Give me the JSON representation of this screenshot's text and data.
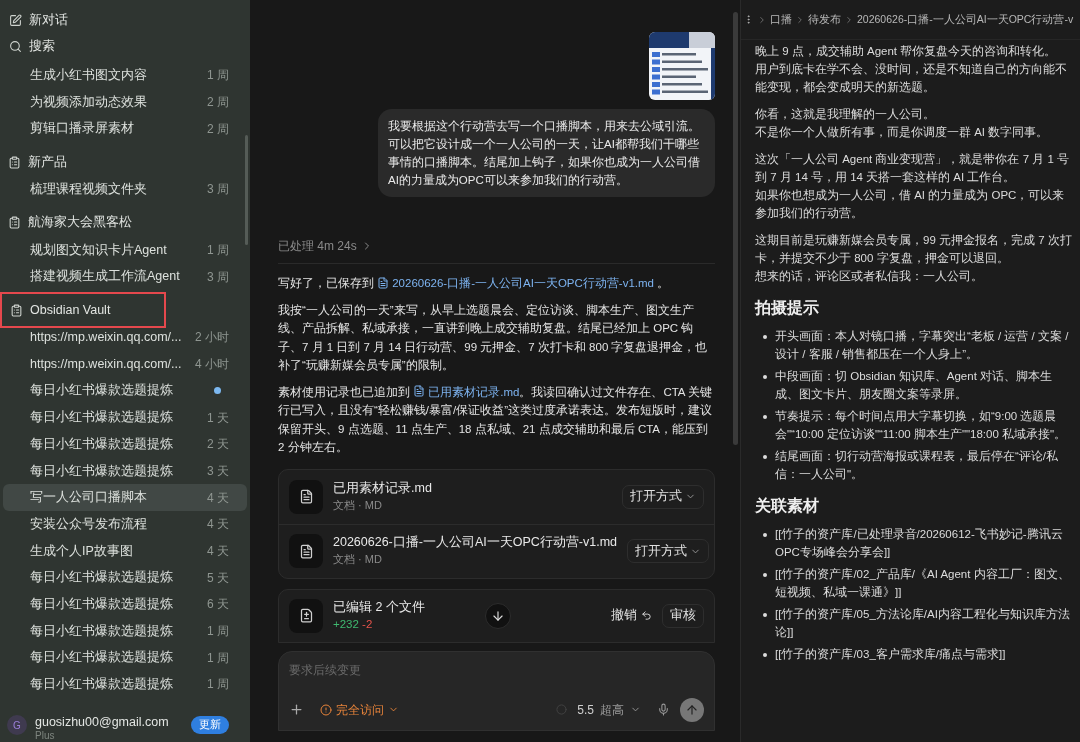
{
  "sidebar": {
    "actions": [
      {
        "kind": "new",
        "label": "新对话"
      },
      {
        "kind": "search",
        "label": "搜索"
      }
    ],
    "chats": [
      {
        "title": "生成小红书图文内容",
        "time": "1 周",
        "selected": false,
        "unread": false
      },
      {
        "title": "为视频添加动态效果",
        "time": "2 周",
        "selected": false,
        "unread": false
      },
      {
        "title": "剪辑口播录屏素材",
        "time": "2 周",
        "selected": false,
        "unread": false
      }
    ],
    "projects": [
      {
        "name": "新产品",
        "annotated": false,
        "chats": [
          {
            "title": "梳理课程视频文件夹",
            "time": "3 周",
            "selected": false,
            "unread": false
          }
        ]
      },
      {
        "name": "航海家大会黑客松",
        "annotated": false,
        "chats": [
          {
            "title": "规划图文知识卡片Agent",
            "time": "1 周",
            "selected": false,
            "unread": false
          },
          {
            "title": "搭建视频生成工作流Agent",
            "time": "3 周",
            "selected": false,
            "unread": false
          }
        ]
      },
      {
        "name": "Obsidian Vault",
        "annotated": true,
        "chats": [
          {
            "title": "https://mp.weixin.qq.com/...",
            "time": "2 小时",
            "selected": false,
            "unread": false
          },
          {
            "title": "https://mp.weixin.qq.com/...",
            "time": "4 小时",
            "selected": false,
            "unread": false
          },
          {
            "title": "每日小红书爆款选题提炼",
            "selected": false,
            "unread": true
          },
          {
            "title": "每日小红书爆款选题提炼",
            "time": "1 天",
            "selected": false,
            "unread": false
          },
          {
            "title": "每日小红书爆款选题提炼",
            "time": "2 天",
            "selected": false,
            "unread": false
          },
          {
            "title": "每日小红书爆款选题提炼",
            "time": "3 天",
            "selected": false,
            "unread": false
          },
          {
            "title": "写一人公司口播脚本",
            "time": "4 天",
            "selected": true,
            "unread": false
          },
          {
            "title": "安装公众号发布流程",
            "time": "4 天",
            "selected": false,
            "unread": false
          },
          {
            "title": "生成个人IP故事图",
            "time": "4 天",
            "selected": false,
            "unread": false
          },
          {
            "title": "每日小红书爆款选题提炼",
            "time": "5 天",
            "selected": false,
            "unread": false
          },
          {
            "title": "每日小红书爆款选题提炼",
            "time": "6 天",
            "selected": false,
            "unread": false
          },
          {
            "title": "每日小红书爆款选题提炼",
            "time": "1 周",
            "selected": false,
            "unread": false
          },
          {
            "title": "每日小红书爆款选题提炼",
            "time": "1 周",
            "selected": false,
            "unread": false
          },
          {
            "title": "每日小红书爆款选题提炼",
            "time": "1 周",
            "selected": false,
            "unread": false
          }
        ]
      }
    ],
    "account": {
      "avatar": "G",
      "email": "guosizhu00@gmail.com",
      "plan": "Plus",
      "button": "更新"
    }
  },
  "chat": {
    "attachment": {
      "kind": "picture"
    },
    "user_message": "我要根据这个行动营去写一个口播脚本，用来去公域引流。可以把它设计成一个一人公司的一天，让AI都帮我们干哪些事情的口播脚本。结尾加上钩子，如果你也成为一人公司借AI的力量成为OPC可以来参加我们的行动营。",
    "worked": "已处理 4m 24s",
    "reply": [
      [
        {
          "kind": "text",
          "text": "写好了，已保存到 "
        },
        {
          "kind": "link",
          "text": "20260626-口播-一人公司AI一天OPC行动营-v1.md"
        },
        {
          "kind": "text",
          "text": " 。"
        }
      ],
      [
        {
          "kind": "text",
          "text": "我按“一人公司的一天”来写，从早上选题晨会、定位访谈、脚本生产、图文生产线、产品拆解、私域承接，一直讲到晚上成交辅助复盘。结尾已经加上 OPC 钩子、7 月 1 日到 7 月 14 日行动营、99 元押金、7 次打卡和 800 字复盘退押金，也补了“玩赚新媒会员专属”的限制。"
        }
      ],
      [
        {
          "kind": "text",
          "text": "素材使用记录也已追加到 "
        },
        {
          "kind": "link",
          "text": "已用素材记录.md"
        },
        {
          "kind": "text",
          "text": "。我读回确认过文件存在、CTA 关键行已写入，且没有“轻松赚钱/暴富/保证收益”这类过度承诺表达。发布短版时，建议保留开头、9 点选题、11 点生产、18 点私域、21 点成交辅助和最后 CTA，能压到 2 分钟左右。"
        }
      ]
    ],
    "files": [
      {
        "name": "已用素材记录.md",
        "meta": "文档 · MD",
        "action": "打开方式"
      },
      {
        "name": "20260626-口播-一人公司AI一天OPC行动营-v1.md",
        "meta": "文档 · MD",
        "action": "打开方式"
      }
    ],
    "edits": {
      "title": "已编辑 2 个文件",
      "added": "+232",
      "removed": "-2",
      "undo": "撤销",
      "review": "审核"
    },
    "composer": {
      "placeholder": "要求后续变更",
      "access": "完全访问",
      "model": "5.5",
      "effort": "超高"
    }
  },
  "document": {
    "breadcrumb": [
      "口播",
      "待发布",
      "20260626-口播-一人公司AI一天OPC行动营-v"
    ],
    "blocks": [
      {
        "kind": "paragraph",
        "lines": [
          "晚上 9 点，成交辅助 Agent 帮你复盘今天的咨询和转化。",
          "用户到底卡在学不会、没时间，还是不知道自己的方向能不能变现，都会变成明天的新选题。"
        ]
      },
      {
        "kind": "paragraph",
        "lines": [
          "你看，这就是我理解的一人公司。",
          "不是你一个人做所有事，而是你调度一群 AI 数字同事。"
        ]
      },
      {
        "kind": "paragraph",
        "lines": [
          "这次「一人公司 Agent 商业变现营」，就是带你在 7 月 1 号到 7 月 14 号，用 14 天搭一套这样的 AI 工作台。",
          "如果你也想成为一人公司，借 AI 的力量成为 OPC，可以来参加我们的行动营。"
        ]
      },
      {
        "kind": "paragraph",
        "lines": [
          "这期目前是玩赚新媒会员专属，99 元押金报名，完成 7 次打卡，并提交不少于 800 字复盘，押金可以退回。",
          "想来的话，评论区或者私信我：一人公司。"
        ]
      },
      {
        "kind": "heading",
        "text": "拍摄提示"
      },
      {
        "kind": "list",
        "items": [
          "开头画面：本人对镜口播，字幕突出“老板 / 运营 / 文案 / 设计 / 客服 / 销售都压在一个人身上”。",
          "中段画面：切 Obsidian 知识库、Agent 对话、脚本生成、图文卡片、朋友圈文案等录屏。",
          "节奏提示：每个时间点用大字幕切换，如“9:00 选题晨会\"“10:00 定位访谈\"“11:00 脚本生产\"\"18:00 私域承接\"。",
          "结尾画面：切行动营海报或课程表，最后停在“评论/私信：一人公司\"。"
        ]
      },
      {
        "kind": "heading",
        "text": "关联素材"
      },
      {
        "kind": "list",
        "items": [
          "[[竹子的资产库/已处理录音/20260612-飞书妙记-腾讯云OPC专场峰会分享会]]",
          "[[竹子的资产库/02_产品库/《AI Agent 内容工厂：图文、短视频、私域一课通》]]",
          "[[竹子的资产库/05_方法论库/AI内容工程化与知识库方法论]]",
          "[[竹子的资产库/03_客户需求库/痛点与需求]]"
        ]
      }
    ]
  }
}
